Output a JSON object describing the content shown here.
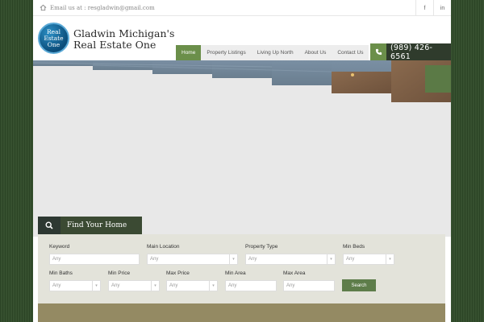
{
  "topbar": {
    "email_text": "Email us at : resgladwin@gmail.com",
    "social": [
      {
        "icon": "facebook-icon",
        "label": "f"
      },
      {
        "icon": "linkedin-icon",
        "label": "in"
      }
    ]
  },
  "brand": {
    "logo_lines": [
      "Real",
      "Estate",
      "One"
    ],
    "title_line1": "Gladwin Michigan's",
    "title_line2": "Real Estate One"
  },
  "nav": {
    "items": [
      {
        "label": "Home",
        "active": true
      },
      {
        "label": "Property Listings",
        "active": false
      },
      {
        "label": "Living Up North",
        "active": false
      },
      {
        "label": "About Us",
        "active": false
      },
      {
        "label": "Contact Us",
        "active": false
      }
    ]
  },
  "phone": {
    "number": "(989) 426-6561",
    "icon": "phone-icon"
  },
  "search": {
    "heading": "Find Your Home",
    "search_button": "Search",
    "fields": {
      "keyword": {
        "label": "Keyword",
        "placeholder": "Any"
      },
      "main_location": {
        "label": "Main Location",
        "value": "Any"
      },
      "property_type": {
        "label": "Property Type",
        "value": "Any"
      },
      "min_beds": {
        "label": "Min Beds",
        "value": "Any"
      },
      "min_baths": {
        "label": "Min Baths",
        "value": "Any"
      },
      "min_price": {
        "label": "Min Price",
        "value": "Any"
      },
      "max_price": {
        "label": "Max Price",
        "value": "Any"
      },
      "min_area": {
        "label": "Min Area",
        "placeholder": "Any"
      },
      "max_area": {
        "label": "Max Area",
        "placeholder": "Any"
      }
    }
  },
  "colors": {
    "accent_green": "#6b8f4a",
    "dark_bar": "#2f3b2c",
    "search_bg": "#e3e3da",
    "background": "#2f4a28"
  }
}
